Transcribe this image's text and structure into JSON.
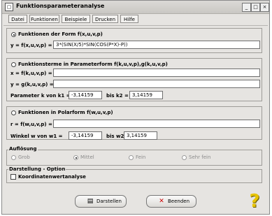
{
  "window": {
    "title": "Funktionsparameteranalyse"
  },
  "menu": [
    "Datei",
    "Funktionen",
    "Beispiele",
    "Drucken",
    "Hilfe"
  ],
  "section1": {
    "radio_label": "Funktionen der Form f(x,u,v,p)",
    "eq_label": "y = f(x,u,v,p) =",
    "eq_value": "3*(SIN(X/5)*SIN(COS(P*X)-P))"
  },
  "section2": {
    "radio_label": "Funktionsterme in Parameterform f(k,u,v,p),g(k,u,v,p)",
    "x_label": "x = f(k,u,v,p) =",
    "x_value": "",
    "y_label": "y = g(k,u,v,p) =",
    "y_value": "",
    "param_label": "Parameter k von k1 =",
    "k1": "-3,14159",
    "to_label": "bis k2 =",
    "k2": "3,14159"
  },
  "section3": {
    "radio_label": "Funktionen in Polarform f(w,u,v,p)",
    "r_label": "r = f(w,u,v,p) =",
    "r_value": "",
    "angle_label": "Winkel w von w1 =",
    "w1": "-3,14159",
    "to_label": "bis w2 =",
    "w2": "3,14159"
  },
  "resolution": {
    "legend": "Auflösung",
    "options": [
      "Grob",
      "Mittel",
      "Fein",
      "Sehr fein"
    ],
    "selected": "Mittel"
  },
  "display": {
    "legend": "Darstellung - Option",
    "checkbox_label": "Koordinatenwertanalyse"
  },
  "buttons": {
    "show": "Darstellen",
    "quit": "Beenden"
  },
  "icons": {
    "show": "chart-icon",
    "quit": "close-x-icon",
    "help": "question-mark-icon"
  },
  "colors": {
    "quit_icon": "#cc0000",
    "help_icon": "#e7c300"
  }
}
